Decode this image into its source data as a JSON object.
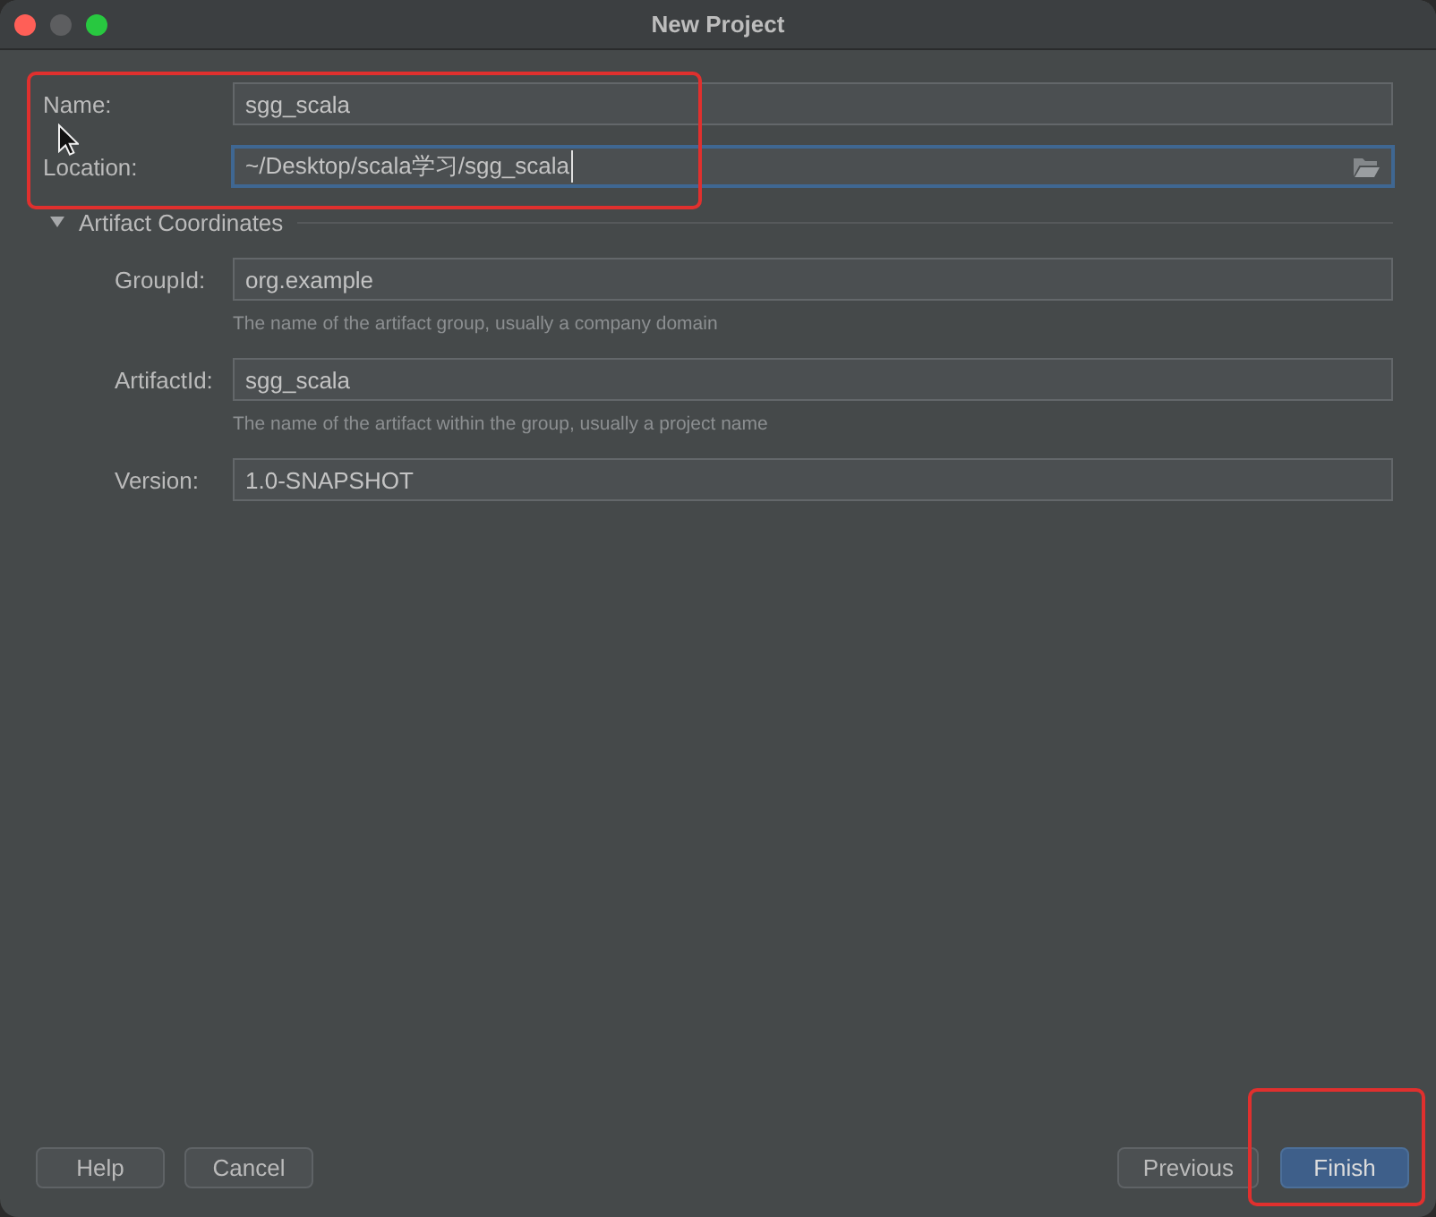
{
  "window": {
    "title": "New Project",
    "controls": [
      {
        "kind": "close",
        "disabled": false
      },
      {
        "kind": "minimize",
        "disabled": true
      },
      {
        "kind": "zoom",
        "disabled": false
      }
    ]
  },
  "project": {
    "highlighted": true,
    "fields": [
      {
        "label": "Name:",
        "value": "sgg_scala",
        "browse": false,
        "focused": false
      },
      {
        "label": "Location:",
        "value": "~/Desktop/scala学习/sgg_scala",
        "browse": true,
        "focused": true
      }
    ]
  },
  "artifact_coordinates": {
    "title": "Artifact Coordinates",
    "expanded": true,
    "fields": [
      {
        "label": "GroupId:",
        "value": "org.example",
        "hint": "The name of the artifact group, usually a company domain",
        "browse": false,
        "focused": false
      },
      {
        "label": "ArtifactId:",
        "value": "sgg_scala",
        "hint": "The name of the artifact within the group, usually a project name",
        "browse": false,
        "focused": false
      },
      {
        "label": "Version:",
        "value": "1.0-SNAPSHOT",
        "browse": false,
        "focused": false
      }
    ]
  },
  "buttons": {
    "left": [
      {
        "label": "Help",
        "default": false,
        "highlighted": false
      },
      {
        "label": "Cancel",
        "default": false,
        "highlighted": false
      }
    ],
    "right": [
      {
        "label": "Previous",
        "default": false,
        "highlighted": false
      },
      {
        "label": "Finish",
        "default": true,
        "highlighted": true
      }
    ]
  }
}
